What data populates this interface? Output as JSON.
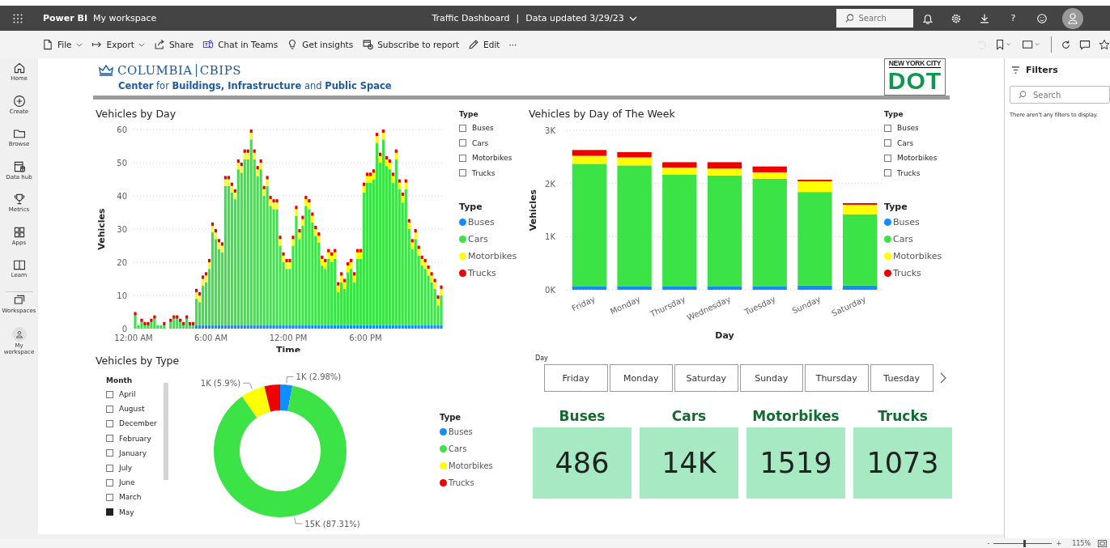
{
  "topbar": {
    "app": "Power BI",
    "workspace": "My workspace",
    "report": "Traffic Dashboard",
    "separator": "|",
    "updated": "Data updated 3/29/23",
    "search": {
      "placeholder": "Search"
    },
    "help": "?"
  },
  "nav": [
    {
      "label": "Home"
    },
    {
      "label": "Create"
    },
    {
      "label": "Browse"
    },
    {
      "label": "Data hub"
    },
    {
      "label": "Metrics"
    },
    {
      "label": "Apps"
    },
    {
      "label": "Learn"
    },
    {
      "label": "Workspaces"
    },
    {
      "label": "My workspace"
    }
  ],
  "toolbar": [
    {
      "label": "File",
      "menu": true
    },
    {
      "label": "Export",
      "menu": true
    },
    {
      "label": "Share",
      "menu": false
    },
    {
      "label": "Chat in Teams",
      "menu": false
    },
    {
      "label": "Get insights",
      "menu": false
    },
    {
      "label": "Subscribe to report",
      "menu": false
    },
    {
      "label": "Edit",
      "menu": false
    },
    {
      "label": "···",
      "menu": false
    }
  ],
  "header": {
    "logo_main": "COLUMBIA",
    "logo_sub": "CBIPS",
    "tagline": "**Center** for **Buildings, Infrastructure** and **Public Space**",
    "dot_top": "NEW YORK CITY",
    "dot_main": "DOT"
  },
  "day_chart": {
    "slicer": {
      "title": "Type",
      "items": [
        {
          "label": "Buses",
          "checked": false
        },
        {
          "label": "Cars",
          "checked": false
        },
        {
          "label": "Motorbikes",
          "checked": false
        },
        {
          "label": "Trucks",
          "checked": false
        }
      ]
    },
    "legend_title": "Type",
    "chart_data": {
      "type": "bar",
      "stacked": true,
      "grid": true,
      "title": "Vehicles by Day",
      "xlabel": "Time",
      "ylabel": "Vehicles",
      "xlim": [
        0,
        24
      ],
      "ylim": [
        0,
        60
      ],
      "yticks": [
        0,
        10,
        20,
        30,
        40,
        50,
        60
      ],
      "xticks": [
        {
          "value": 0,
          "label": "12:00 AM"
        },
        {
          "value": 6,
          "label": "6:00 AM"
        },
        {
          "value": 12,
          "label": "12:00 PM"
        },
        {
          "value": 18,
          "label": "6:00 PM"
        }
      ],
      "x": [
        0,
        0.25,
        0.5,
        0.75,
        1,
        1.25,
        1.5,
        1.75,
        2,
        2.25,
        2.5,
        2.75,
        3,
        3.25,
        3.5,
        3.75,
        4,
        4.25,
        4.5,
        4.75,
        5,
        5.25,
        5.5,
        5.75,
        6,
        6.25,
        6.5,
        6.75,
        7,
        7.25,
        7.5,
        7.75,
        8,
        8.25,
        8.5,
        8.75,
        9,
        9.25,
        9.5,
        9.75,
        10,
        10.25,
        10.5,
        10.75,
        11,
        11.25,
        11.5,
        11.75,
        12,
        12.25,
        12.5,
        12.75,
        13,
        13.25,
        13.5,
        13.75,
        14,
        14.25,
        14.5,
        14.75,
        15,
        15.25,
        15.5,
        15.75,
        16,
        16.25,
        16.5,
        16.75,
        17,
        17.25,
        17.5,
        17.75,
        18,
        18.25,
        18.5,
        18.75,
        19,
        19.25,
        19.5,
        19.75,
        20,
        20.25,
        20.5,
        20.75,
        21,
        21.25,
        21.5,
        21.75,
        22,
        22.25,
        22.5,
        22.75,
        23,
        23.25,
        23.5,
        23.75
      ],
      "series": [
        {
          "name": "Buses",
          "color": "#118dff",
          "values": [
            0,
            0,
            0,
            0,
            0,
            0,
            0,
            0,
            0,
            0,
            0,
            0,
            0,
            0,
            0,
            0,
            0,
            0,
            0,
            1,
            1,
            1,
            1,
            1,
            1,
            1,
            1,
            1,
            1,
            1,
            1,
            1,
            1,
            1,
            1,
            1,
            1,
            1,
            1,
            1,
            1,
            1,
            1,
            1,
            1,
            1,
            1,
            1,
            1,
            1,
            1,
            1,
            1,
            1,
            1,
            1,
            1,
            1,
            1,
            1,
            1,
            1,
            1,
            1,
            1,
            1,
            1,
            1,
            1,
            1,
            1,
            1,
            1,
            1,
            1,
            1,
            1,
            1,
            1,
            1,
            1,
            1,
            1,
            1,
            1,
            1,
            1,
            1,
            1,
            1,
            1,
            1,
            1,
            1,
            1,
            1
          ]
        },
        {
          "name": "Cars",
          "color": "#3be346",
          "values": [
            4,
            1,
            2,
            1,
            1,
            2,
            3,
            1,
            1,
            1,
            0,
            2,
            3,
            3,
            2,
            1,
            3,
            1,
            1,
            8,
            7,
            12,
            13,
            17,
            28,
            26,
            23,
            22,
            42,
            42,
            40,
            38,
            47,
            46,
            50,
            50,
            56,
            50,
            45,
            47,
            39,
            42,
            36,
            35,
            35,
            24,
            19,
            17,
            17,
            24,
            33,
            26,
            30,
            36,
            35,
            31,
            27,
            25,
            18,
            17,
            20,
            19,
            20,
            10,
            13,
            11,
            16,
            17,
            13,
            20,
            20,
            40,
            43,
            43,
            44,
            55,
            49,
            56,
            48,
            47,
            43,
            50,
            41,
            37,
            41,
            29,
            23,
            26,
            21,
            18,
            17,
            15,
            13,
            11,
            6,
            9
          ]
        },
        {
          "name": "Motorbikes",
          "color": "#ffff00",
          "values": [
            0,
            0,
            0,
            0,
            0,
            0,
            0,
            0,
            0,
            0,
            0,
            0,
            0,
            0,
            0,
            0,
            0,
            0,
            0,
            2,
            2,
            2,
            2,
            2,
            2,
            2,
            2,
            2,
            2,
            2,
            2,
            2,
            2,
            2,
            2,
            2,
            2,
            2,
            2,
            2,
            2,
            2,
            2,
            2,
            2,
            2,
            2,
            2,
            2,
            2,
            2,
            2,
            2,
            2,
            2,
            2,
            2,
            2,
            2,
            2,
            2,
            2,
            2,
            2,
            2,
            2,
            2,
            2,
            2,
            2,
            2,
            2,
            2,
            2,
            2,
            2,
            2,
            2,
            2,
            2,
            2,
            2,
            2,
            2,
            2,
            2,
            2,
            2,
            2,
            2,
            2,
            2,
            2,
            2,
            2,
            2
          ]
        },
        {
          "name": "Trucks",
          "color": "#ee0000",
          "values": [
            1,
            0,
            1,
            1,
            1,
            1,
            1,
            0,
            0,
            1,
            0,
            1,
            1,
            1,
            1,
            1,
            1,
            1,
            1,
            1,
            1,
            1,
            1,
            1,
            1,
            1,
            1,
            1,
            1,
            1,
            1,
            1,
            1,
            1,
            1,
            1,
            1,
            1,
            1,
            1,
            1,
            1,
            1,
            1,
            1,
            1,
            1,
            1,
            1,
            1,
            1,
            1,
            1,
            1,
            1,
            1,
            1,
            1,
            1,
            1,
            1,
            1,
            1,
            1,
            1,
            1,
            1,
            1,
            1,
            1,
            1,
            1,
            1,
            1,
            1,
            1,
            1,
            1,
            1,
            1,
            1,
            1,
            1,
            1,
            1,
            1,
            1,
            1,
            1,
            1,
            1,
            1,
            1,
            1,
            1,
            1
          ]
        }
      ]
    }
  },
  "week_chart": {
    "slicer": {
      "title": "Type",
      "items": [
        {
          "label": "Buses",
          "checked": false
        },
        {
          "label": "Cars",
          "checked": false
        },
        {
          "label": "Motorbikes",
          "checked": false
        },
        {
          "label": "Trucks",
          "checked": false
        }
      ]
    },
    "legend_title": "Type",
    "chart_data": {
      "type": "bar",
      "stacked": true,
      "grid": true,
      "title": "Vehicles by Day of The Week",
      "xlabel": "Day",
      "ylabel": "Vehicles",
      "categories": [
        "Friday",
        "Monday",
        "Thursday",
        "Wednesday",
        "Tuesday",
        "Sunday",
        "Saturday"
      ],
      "ylim": [
        0,
        3000
      ],
      "yticks": [
        {
          "value": 0,
          "label": "0K"
        },
        {
          "value": 1000,
          "label": "1K"
        },
        {
          "value": 2000,
          "label": "2K"
        },
        {
          "value": 3000,
          "label": "3K"
        }
      ],
      "series": [
        {
          "name": "Buses",
          "color": "#118dff",
          "values": [
            70,
            70,
            70,
            70,
            70,
            80,
            80
          ]
        },
        {
          "name": "Cars",
          "color": "#3be346",
          "values": [
            2300,
            2270,
            2100,
            2080,
            2020,
            1760,
            1340
          ]
        },
        {
          "name": "Motorbikes",
          "color": "#ffff00",
          "values": [
            150,
            150,
            130,
            130,
            120,
            200,
            180
          ]
        },
        {
          "name": "Trucks",
          "color": "#ee0000",
          "values": [
            110,
            100,
            100,
            120,
            110,
            30,
            30
          ]
        }
      ]
    }
  },
  "type_chart": {
    "month_slicer": {
      "title": "Month",
      "items": [
        {
          "label": "April",
          "checked": false
        },
        {
          "label": "August",
          "checked": false
        },
        {
          "label": "December",
          "checked": false
        },
        {
          "label": "February",
          "checked": false
        },
        {
          "label": "January",
          "checked": false
        },
        {
          "label": "July",
          "checked": false
        },
        {
          "label": "June",
          "checked": false
        },
        {
          "label": "March",
          "checked": false
        },
        {
          "label": "May",
          "checked": true
        }
      ]
    },
    "legend_title": "Type",
    "chart_data": {
      "type": "donut",
      "title": "Vehicles by Type",
      "categories": [
        "Buses",
        "Cars",
        "Motorbikes",
        "Trucks"
      ],
      "colors": [
        "#118dff",
        "#3be346",
        "#ffff00",
        "#ee0000"
      ],
      "values": [
        2.98,
        87.31,
        5.9,
        3.81
      ],
      "value_labels": [
        "1K (2.98%)",
        "15K (87.31%)",
        "1K (5.9%)",
        null
      ]
    }
  },
  "day_slicer": {
    "title": "Day",
    "items": [
      {
        "label": "Friday",
        "selected": false
      },
      {
        "label": "Monday",
        "selected": false
      },
      {
        "label": "Saturday",
        "selected": false
      },
      {
        "label": "Sunday",
        "selected": false
      },
      {
        "label": "Thursday",
        "selected": false
      },
      {
        "label": "Tuesday",
        "selected": false
      }
    ]
  },
  "cards": [
    {
      "label": "Buses",
      "value": "486"
    },
    {
      "label": "Cars",
      "value": "14K"
    },
    {
      "label": "Motorbikes",
      "value": "1519"
    },
    {
      "label": "Trucks",
      "value": "1073"
    }
  ],
  "filters": {
    "title": "Filters",
    "search": {
      "placeholder": "Search"
    },
    "empty": "There aren't any filters to display."
  },
  "status": {
    "minus": "-",
    "plus": "+",
    "zoom": {
      "level": 0.52
    },
    "reading": "115%"
  }
}
